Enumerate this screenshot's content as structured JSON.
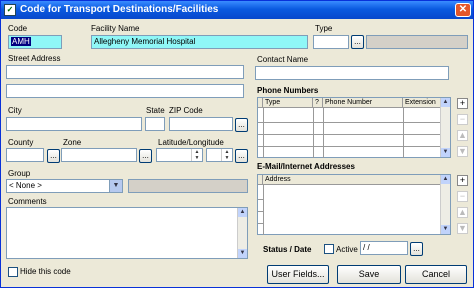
{
  "window": {
    "title": "Code for Transport Destinations/Facilities",
    "close": "✕",
    "app_icon": "✓"
  },
  "labels": {
    "code": "Code",
    "facility_name": "Facility Name",
    "type": "Type",
    "street_address": "Street Address",
    "contact_name": "Contact Name",
    "city": "City",
    "state": "State",
    "zip": "ZIP Code",
    "county": "County",
    "zone": "Zone",
    "latlong": "Latitude/Longitude",
    "group": "Group",
    "comments": "Comments",
    "hide": "Hide this code",
    "phone_numbers": "Phone Numbers",
    "email": "E-Mail/Internet Addresses",
    "status_date": "Status / Date",
    "active": "Active"
  },
  "values": {
    "code": "AMH",
    "facility_name": "Allegheny Memorial Hospital",
    "group": "< None >",
    "status_date": " / /"
  },
  "phone_grid": {
    "columns": [
      "Type",
      "?",
      "Phone Number",
      "Extension"
    ]
  },
  "email_grid": {
    "columns": [
      "Address"
    ]
  },
  "buttons": {
    "ellipsis": "...",
    "user_fields": "User Fields...",
    "save": "Save",
    "cancel": "Cancel",
    "plus": "+",
    "minus": "−"
  },
  "icons": {
    "up": "▲",
    "down": "▼"
  }
}
